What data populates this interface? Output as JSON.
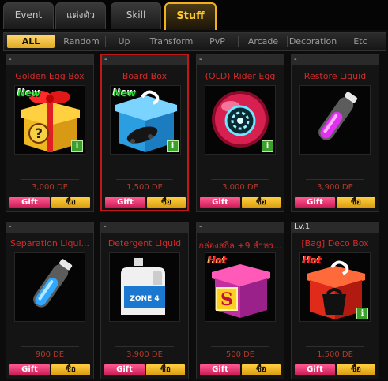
{
  "tabs": [
    {
      "label": "Event"
    },
    {
      "label": "แต่งตัว"
    },
    {
      "label": "Skill"
    },
    {
      "label": "Stuff"
    }
  ],
  "active_tab": "Stuff",
  "categories": [
    {
      "label": "ALL"
    },
    {
      "label": "Random"
    },
    {
      "label": "Up"
    },
    {
      "label": "Transform"
    },
    {
      "label": "PvP"
    },
    {
      "label": "Arcade"
    },
    {
      "label": "Decoration"
    },
    {
      "label": "Etc"
    }
  ],
  "active_category": "ALL",
  "buttons": {
    "gift": "Gift",
    "buy": "ซื้อ"
  },
  "items": [
    {
      "header": "-",
      "name": "Golden Egg Box",
      "price": "3,000 DE",
      "badge": "New",
      "info": "i",
      "icon": "golden-egg-box-icon"
    },
    {
      "header": "-",
      "name": "Board Box",
      "price": "1,500 DE",
      "badge": "New",
      "info": "i",
      "icon": "board-box-icon"
    },
    {
      "header": "-",
      "name": "(OLD) Rider Egg",
      "price": "3,000 DE",
      "badge": "",
      "info": "i",
      "icon": "rider-egg-icon"
    },
    {
      "header": "-",
      "name": "Restore Liquid",
      "price": "3,900 DE",
      "badge": "",
      "info": "",
      "icon": "purple-vial-icon"
    },
    {
      "header": "-",
      "name": "Separation Liqui...",
      "price": "900 DE",
      "badge": "",
      "info": "",
      "icon": "blue-vial-icon"
    },
    {
      "header": "-",
      "name": "Detergent Liquid",
      "price": "3,900 DE",
      "badge": "",
      "info": "",
      "icon": "detergent-bottle-icon"
    },
    {
      "header": "-",
      "name": "กล่องสกิล +9 สำหร...",
      "price": "500 DE",
      "badge": "Hot",
      "info": "",
      "icon": "skill-box-icon"
    },
    {
      "header": "Lv.1",
      "name": "[Bag] Deco Box",
      "price": "1,500 DE",
      "badge": "Hot",
      "info": "i",
      "icon": "deco-box-icon"
    }
  ],
  "colors": {
    "active_tab": "#f0b020",
    "item_name": "#d42a2a",
    "gift": "#e0306a",
    "buy": "#f0b020",
    "selected_border": "#c01818"
  }
}
